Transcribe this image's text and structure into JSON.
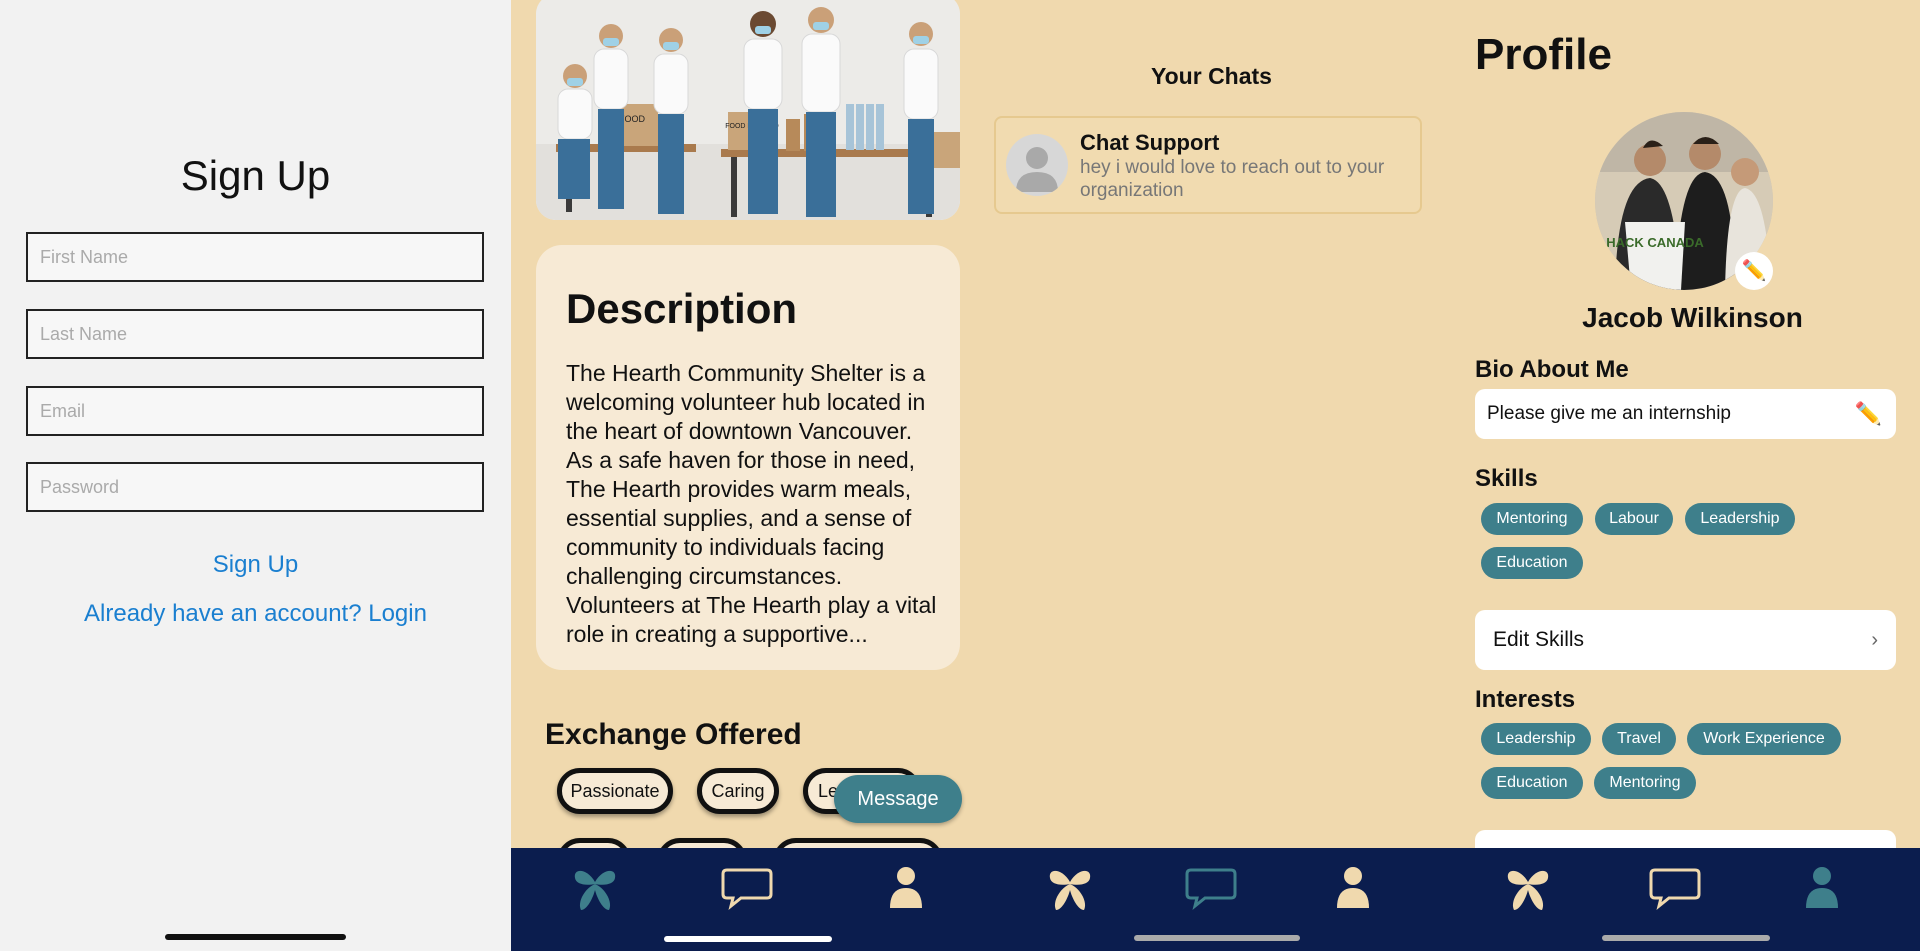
{
  "signup": {
    "title": "Sign Up",
    "first_name_placeholder": "First Name",
    "last_name_placeholder": "Last Name",
    "email_placeholder": "Email",
    "password_placeholder": "Password",
    "signup_button": "Sign Up",
    "login_link": "Already have an account? Login"
  },
  "opportunity": {
    "description_title": "Description",
    "description_text": "The Hearth Community Shelter is a welcoming volunteer hub located in the heart of downtown Vancouver. As a safe haven for those in need, The Hearth provides warm meals, essential supplies, and a sense of community to individuals facing challenging circumstances. Volunteers at The Hearth play a vital role in creating a supportive...",
    "exchange_title": "Exchange Offered",
    "exchange_tags": [
      "Passionate",
      "Caring",
      "Le"
    ],
    "message_button": "Message",
    "hero_labels": [
      "FOOD",
      "FOOD DONATIO",
      "FOOD DONATION"
    ]
  },
  "chats": {
    "title": "Your Chats",
    "items": [
      {
        "name": "Chat Support",
        "message": "hey i would love to reach out to your organization"
      }
    ]
  },
  "profile": {
    "title": "Profile",
    "name": "Jacob Wilkinson",
    "bio_label": "Bio About Me",
    "bio_value": "Please give me an internship",
    "skills_label": "Skills",
    "skills": [
      "Mentoring",
      "Labour",
      "Leadership",
      "Education"
    ],
    "edit_skills": "Edit Skills",
    "interests_label": "Interests",
    "interests": [
      "Leadership",
      "Travel",
      "Work Experience",
      "Education",
      "Mentoring"
    ],
    "shirt_text": "HACK CANADA"
  },
  "tabbar": {
    "items": [
      "home-icon",
      "chat-icon",
      "profile-icon"
    ],
    "active_color": "#3e7f8b",
    "inactive_color": "#f0d9ae",
    "background": "#0b1d4e"
  }
}
